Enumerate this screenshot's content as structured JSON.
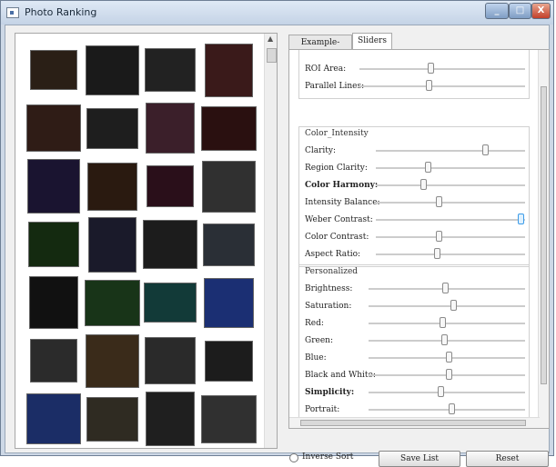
{
  "window": {
    "title": "Photo Ranking",
    "controls": [
      "_",
      "□",
      "X"
    ]
  },
  "tabs": [
    {
      "label": "Example-based",
      "active": false
    },
    {
      "label": "Sliders",
      "active": true
    }
  ],
  "groups": [
    {
      "title": "",
      "items": [
        {
          "label": "ROI Area:",
          "bold": false,
          "value": 0.43
        },
        {
          "label": "Parallel Lines:",
          "bold": false,
          "value": 0.42
        }
      ]
    },
    {
      "title": "Color_Intensity",
      "items": [
        {
          "label": "Clarity:",
          "bold": false,
          "value": 0.73
        },
        {
          "label": "Region Clarity:",
          "bold": false,
          "value": 0.35
        },
        {
          "label": "Color Harmony:",
          "bold": true,
          "value": 0.32
        },
        {
          "label": "Intensity Balance:",
          "bold": false,
          "value": 0.42
        },
        {
          "label": "Weber Contrast:",
          "bold": false,
          "value": 0.97
        },
        {
          "label": "Color Contrast:",
          "bold": false,
          "value": 0.42
        },
        {
          "label": "Aspect Ratio:",
          "bold": false,
          "value": 0.41
        }
      ]
    },
    {
      "title": "Personalized",
      "items": [
        {
          "label": "Brightness:",
          "bold": false,
          "value": 0.49
        },
        {
          "label": "Saturation:",
          "bold": false,
          "value": 0.54
        },
        {
          "label": "Red:",
          "bold": false,
          "value": 0.47
        },
        {
          "label": "Green:",
          "bold": false,
          "value": 0.48
        },
        {
          "label": "Blue:",
          "bold": false,
          "value": 0.51
        },
        {
          "label": "Black and White:",
          "bold": false,
          "value": 0.51
        },
        {
          "label": "Simplicity:",
          "bold": true,
          "value": 0.46
        },
        {
          "label": "Portrait:",
          "bold": false,
          "value": 0.53
        }
      ]
    }
  ],
  "bottom": {
    "radio_label": "Inverse Sort",
    "save_label": "Save List",
    "reset_label": "Reset"
  },
  "thumb_colors": [
    "#2a1f16",
    "#1a1a1a",
    "#222",
    "#3a1a1a",
    "#2f1c16",
    "#1e1e1e",
    "#3b1f2a",
    "#2a1010",
    "#1a1430",
    "#2a1a10",
    "#2a0f1a",
    "#303030",
    "#142a10",
    "#1a1a2a",
    "#1c1c1c",
    "#2a2f36",
    "#111",
    "#183418",
    "#123a38",
    "#1b2f73",
    "#2b2b2b",
    "#3a2b1a",
    "#2a2a2a",
    "#1c1c1c",
    "#1b2d66",
    "#2f2b22",
    "#1f1f1f",
    "#303030"
  ]
}
